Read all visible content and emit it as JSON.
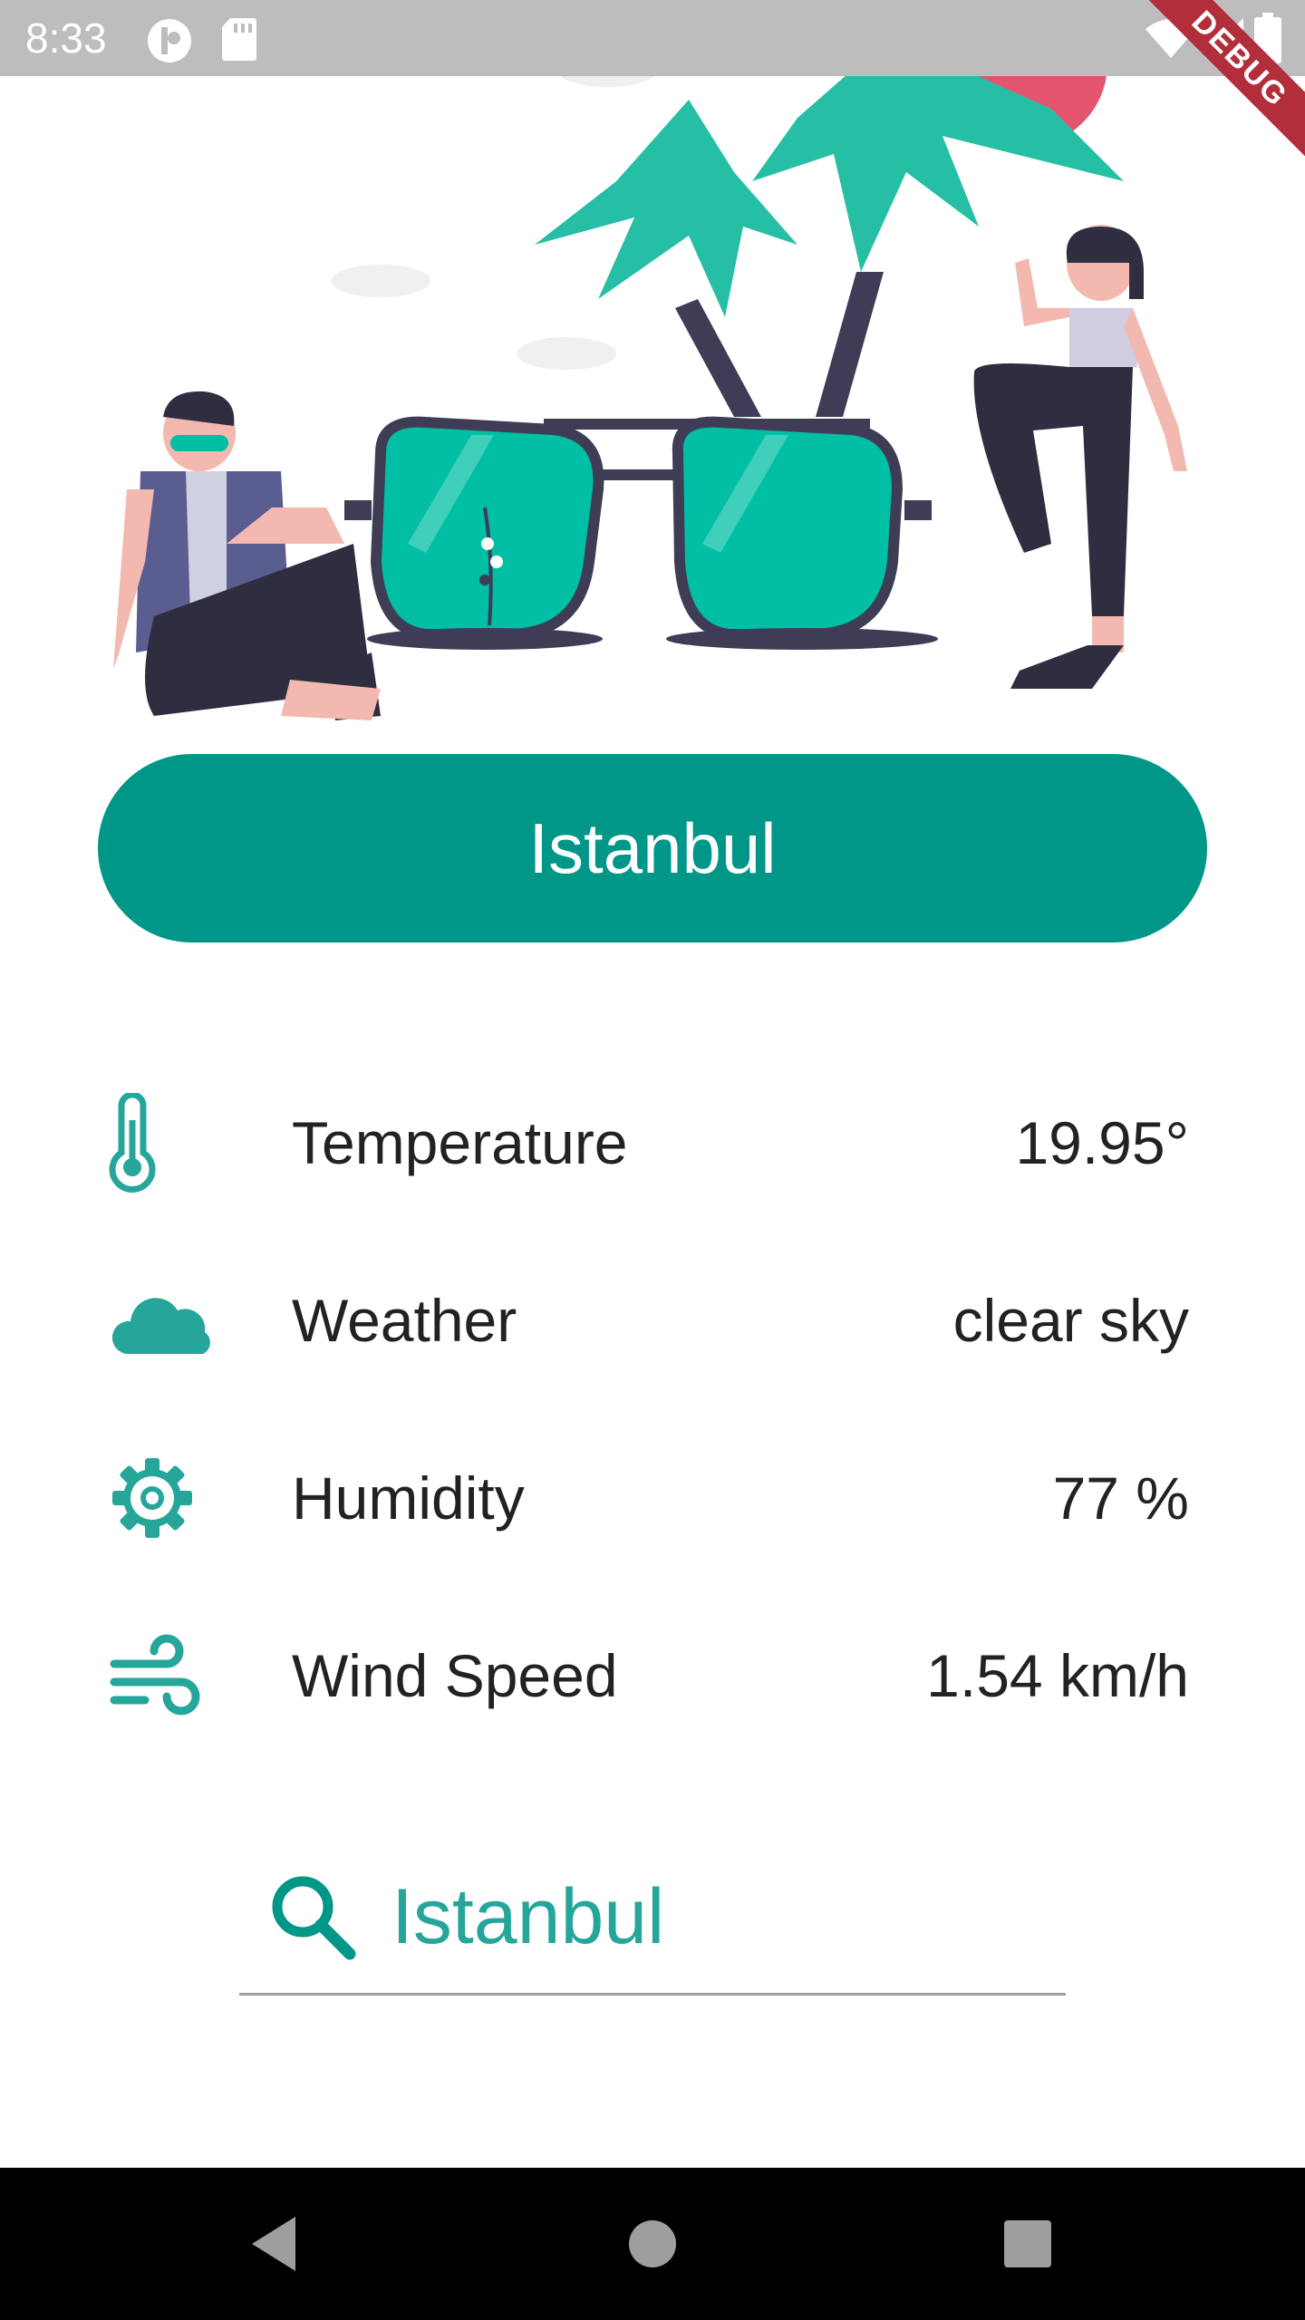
{
  "status_bar": {
    "time": "8:33",
    "icons": [
      "profile-icon",
      "sd-card-icon",
      "wifi-icon",
      "signal-icon",
      "battery-icon"
    ]
  },
  "debug_banner": "DEBUG",
  "colors": {
    "primary": "#009688",
    "accent": "#26a69a",
    "text": "#222222"
  },
  "city_button": {
    "label": "Istanbul"
  },
  "weather_rows": [
    {
      "icon": "thermometer-icon",
      "label": "Temperature",
      "value": "19.95°"
    },
    {
      "icon": "cloud-icon",
      "label": "Weather",
      "value": "clear sky"
    },
    {
      "icon": "gear-icon",
      "label": "Humidity",
      "value": "77 %"
    },
    {
      "icon": "wind-icon",
      "label": "Wind Speed",
      "value": "1.54 km/h"
    }
  ],
  "search": {
    "value": "Istanbul",
    "icon": "search-icon"
  },
  "nav_bar": {
    "buttons": [
      "back-icon",
      "home-icon",
      "recents-icon"
    ]
  }
}
